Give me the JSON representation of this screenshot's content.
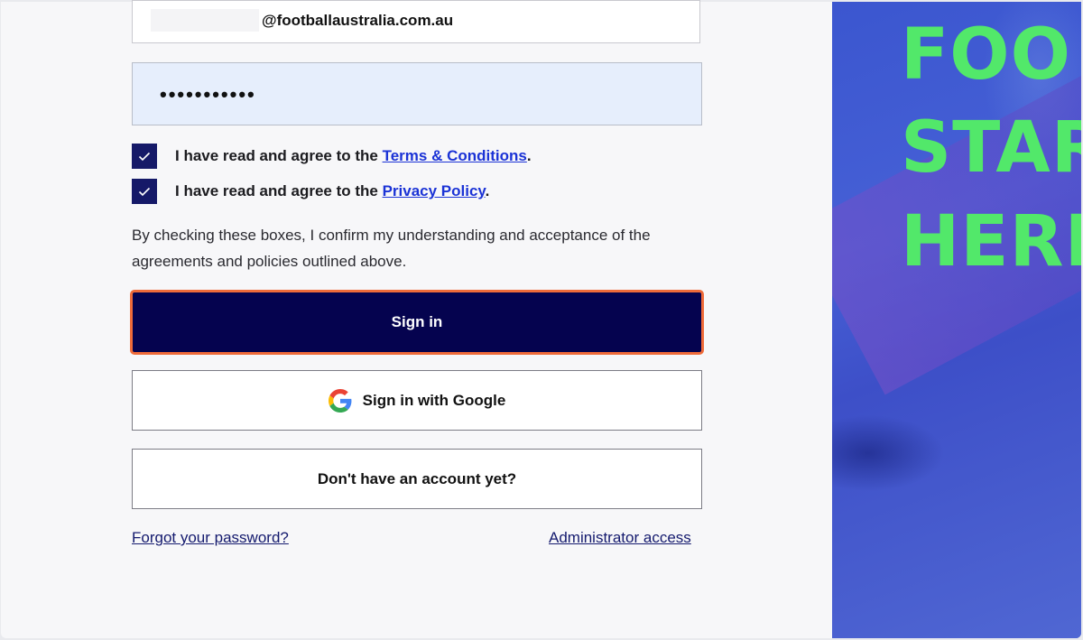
{
  "login": {
    "email_domain": "@footballaustralia.com.au",
    "password_masked": "•••••••••••",
    "terms_prefix": "I have read and agree to the ",
    "terms_link": "Terms & Conditions",
    "terms_suffix": ".",
    "privacy_prefix": "I have read and agree to the ",
    "privacy_link": "Privacy Policy",
    "privacy_suffix": ".",
    "terms_checked": true,
    "privacy_checked": true,
    "disclaimer": "By checking these boxes, I confirm my understanding and acceptance of the agreements and policies outlined above.",
    "signin_label": "Sign in",
    "google_label": "Sign in with Google",
    "no_account_label": "Don't have an account yet?",
    "forgot_password": "Forgot your password?",
    "admin_access": "Administrator access"
  },
  "hero": {
    "line1": "FOO",
    "line2": "STAR",
    "line3": "HERI"
  },
  "colors": {
    "primary": "#05034f",
    "focus_ring": "#ef6b3a",
    "link": "#1b33d6",
    "hero_text": "#52e86a",
    "hero_bg": "#3a4fd0"
  }
}
